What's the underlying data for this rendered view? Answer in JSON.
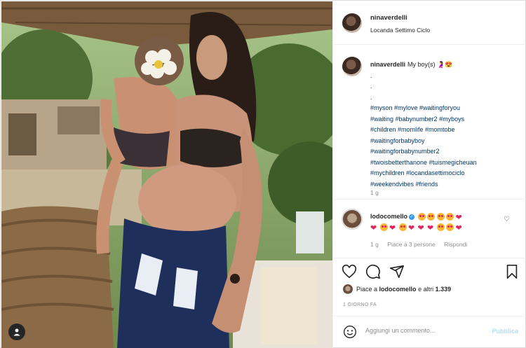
{
  "post": {
    "username": "ninaverdelli",
    "location": "Locanda Settimo Ciclo"
  },
  "caption": {
    "username": "ninaverdelli",
    "text": "My boy(s) 🤰😍",
    "dots": [
      ".",
      ".",
      "."
    ],
    "hashtag_lines": [
      "#myson #mylove #waitingforyou",
      "#waiting #babynumber2 #myboys",
      "#children #momlife #momtobe",
      "#waitingforbabyboy",
      "#waitingforbabynumber2",
      "#twoisbetterthanone #tuismegicheuan",
      "#mychildren #locandasettimociclo",
      "#weekendvibes #friends"
    ],
    "time": "1 g"
  },
  "comment": {
    "username": "lodocomello",
    "reply_meta": {
      "time": "1 g",
      "likes": "Piace a 3 persone",
      "reply": "Rispondi"
    }
  },
  "likes": {
    "prefix": "Piace a ",
    "user": "lodocomello",
    "middle": " e altri ",
    "count": "1.339"
  },
  "date": "1 GIORNO FA",
  "add_comment": {
    "placeholder": "Aggiungi un commento...",
    "publish": "Pubblica"
  },
  "icons": {
    "like": "heart-icon",
    "comment": "comment-icon",
    "share": "share-icon",
    "save": "bookmark-icon",
    "emoji": "smiley-icon",
    "user_tag": "user-tag-icon"
  },
  "colors": {
    "link": "#00376b",
    "secondary_text": "#8e8e8e",
    "publish_disabled": "#b2dffc",
    "verified": "#3897f0"
  }
}
